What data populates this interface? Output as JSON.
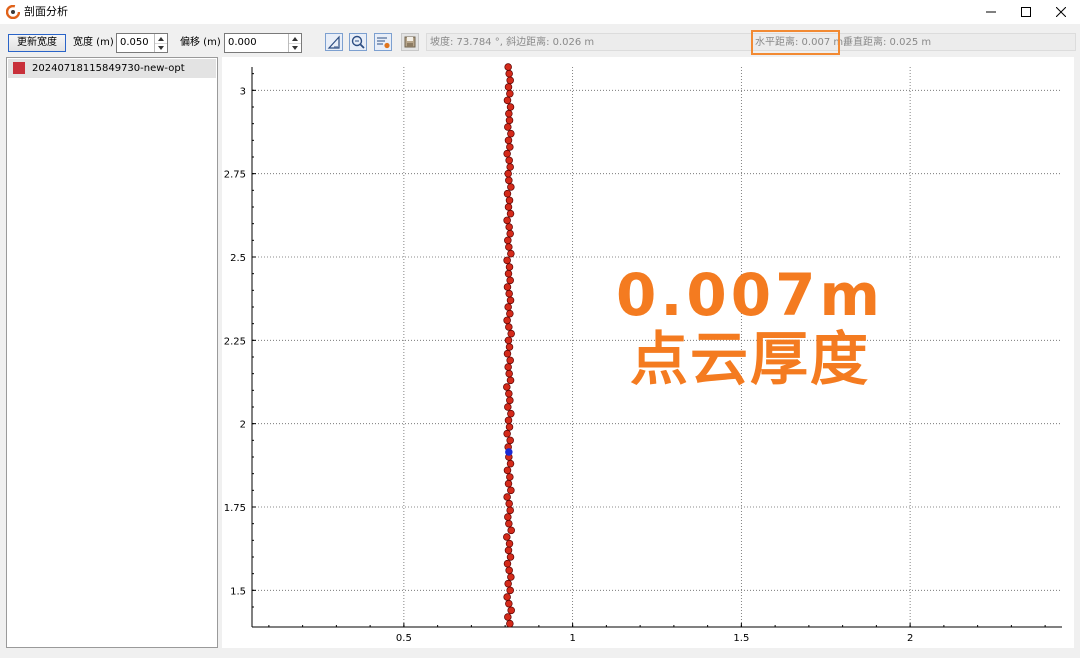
{
  "window": {
    "title": "剖面分析",
    "controls": [
      "minimize-icon",
      "maximize-icon",
      "close-icon"
    ]
  },
  "toolbar": {
    "update_width_label": "更新宽度",
    "width_label": "宽度 (m)",
    "width_value": "0.050",
    "offset_label": "偏移 (m)",
    "offset_value": "0.000",
    "tool_icons": [
      "ruler-icon",
      "zoom-fit-icon",
      "settings-list-icon",
      "save-icon"
    ],
    "slope_text": "坡度: 73.784 °, 斜边距离: 0.026 m",
    "horizontal_text": "水平距离: 0.007 m,",
    "vertical_text": "垂直距离: 0.025 m"
  },
  "layers": [
    {
      "name": "20240718115849730-new-opt",
      "color": "#c8303a"
    }
  ],
  "overlay": {
    "line1": "0.007m",
    "line2": "点云厚度",
    "color": "#f47b20"
  },
  "chart_data": {
    "type": "scatter",
    "title": "",
    "xlabel": "",
    "ylabel": "",
    "xlim": [
      0.05,
      2.45
    ],
    "ylim": [
      1.39,
      3.07
    ],
    "x_ticks": [
      0.5,
      1,
      1.5,
      2
    ],
    "x_tick_labels": [
      "0.5",
      "1",
      "1.5",
      "2"
    ],
    "y_ticks": [
      1.5,
      1.75,
      2,
      2.25,
      2.5,
      2.75,
      3
    ],
    "y_tick_labels": [
      "1.5",
      "1.75",
      "2",
      "2.25",
      "2.5",
      "2.75",
      "3"
    ],
    "grid": true,
    "series": [
      {
        "color": "#d42a1a",
        "edge_color": "#5a0000",
        "points": [
          [
            0.814,
            1.4
          ],
          [
            0.808,
            1.42
          ],
          [
            0.818,
            1.44
          ],
          [
            0.811,
            1.46
          ],
          [
            0.806,
            1.48
          ],
          [
            0.815,
            1.5
          ],
          [
            0.809,
            1.52
          ],
          [
            0.817,
            1.54
          ],
          [
            0.812,
            1.56
          ],
          [
            0.807,
            1.58
          ],
          [
            0.816,
            1.6
          ],
          [
            0.81,
            1.62
          ],
          [
            0.813,
            1.64
          ],
          [
            0.805,
            1.66
          ],
          [
            0.818,
            1.68
          ],
          [
            0.811,
            1.7
          ],
          [
            0.808,
            1.72
          ],
          [
            0.815,
            1.74
          ],
          [
            0.812,
            1.76
          ],
          [
            0.806,
            1.78
          ],
          [
            0.817,
            1.8
          ],
          [
            0.81,
            1.82
          ],
          [
            0.814,
            1.84
          ],
          [
            0.807,
            1.86
          ],
          [
            0.816,
            1.88
          ],
          [
            0.811,
            1.9
          ],
          [
            0.809,
            1.93
          ],
          [
            0.815,
            1.95
          ],
          [
            0.806,
            1.97
          ],
          [
            0.813,
            1.99
          ],
          [
            0.81,
            2.01
          ],
          [
            0.817,
            2.03
          ],
          [
            0.808,
            2.05
          ],
          [
            0.814,
            2.07
          ],
          [
            0.811,
            2.09
          ],
          [
            0.805,
            2.11
          ],
          [
            0.816,
            2.13
          ],
          [
            0.812,
            2.15
          ],
          [
            0.809,
            2.17
          ],
          [
            0.815,
            2.19
          ],
          [
            0.807,
            2.21
          ],
          [
            0.813,
            2.23
          ],
          [
            0.81,
            2.25
          ],
          [
            0.818,
            2.27
          ],
          [
            0.811,
            2.29
          ],
          [
            0.806,
            2.31
          ],
          [
            0.814,
            2.33
          ],
          [
            0.809,
            2.35
          ],
          [
            0.816,
            2.37
          ],
          [
            0.812,
            2.39
          ],
          [
            0.807,
            2.41
          ],
          [
            0.815,
            2.43
          ],
          [
            0.81,
            2.45
          ],
          [
            0.813,
            2.47
          ],
          [
            0.806,
            2.49
          ],
          [
            0.817,
            2.51
          ],
          [
            0.811,
            2.53
          ],
          [
            0.808,
            2.55
          ],
          [
            0.815,
            2.57
          ],
          [
            0.812,
            2.59
          ],
          [
            0.806,
            2.61
          ],
          [
            0.816,
            2.63
          ],
          [
            0.81,
            2.65
          ],
          [
            0.813,
            2.67
          ],
          [
            0.807,
            2.69
          ],
          [
            0.817,
            2.71
          ],
          [
            0.811,
            2.73
          ],
          [
            0.809,
            2.75
          ],
          [
            0.815,
            2.77
          ],
          [
            0.812,
            2.79
          ],
          [
            0.806,
            2.81
          ],
          [
            0.814,
            2.83
          ],
          [
            0.81,
            2.85
          ],
          [
            0.817,
            2.87
          ],
          [
            0.808,
            2.89
          ],
          [
            0.813,
            2.91
          ],
          [
            0.811,
            2.93
          ],
          [
            0.816,
            2.95
          ],
          [
            0.807,
            2.97
          ],
          [
            0.814,
            2.99
          ],
          [
            0.81,
            3.01
          ],
          [
            0.815,
            3.03
          ],
          [
            0.812,
            3.05
          ],
          [
            0.809,
            3.07
          ]
        ]
      },
      {
        "color": "#1a2ad4",
        "points": [
          [
            0.811,
            1.915
          ]
        ]
      }
    ]
  }
}
